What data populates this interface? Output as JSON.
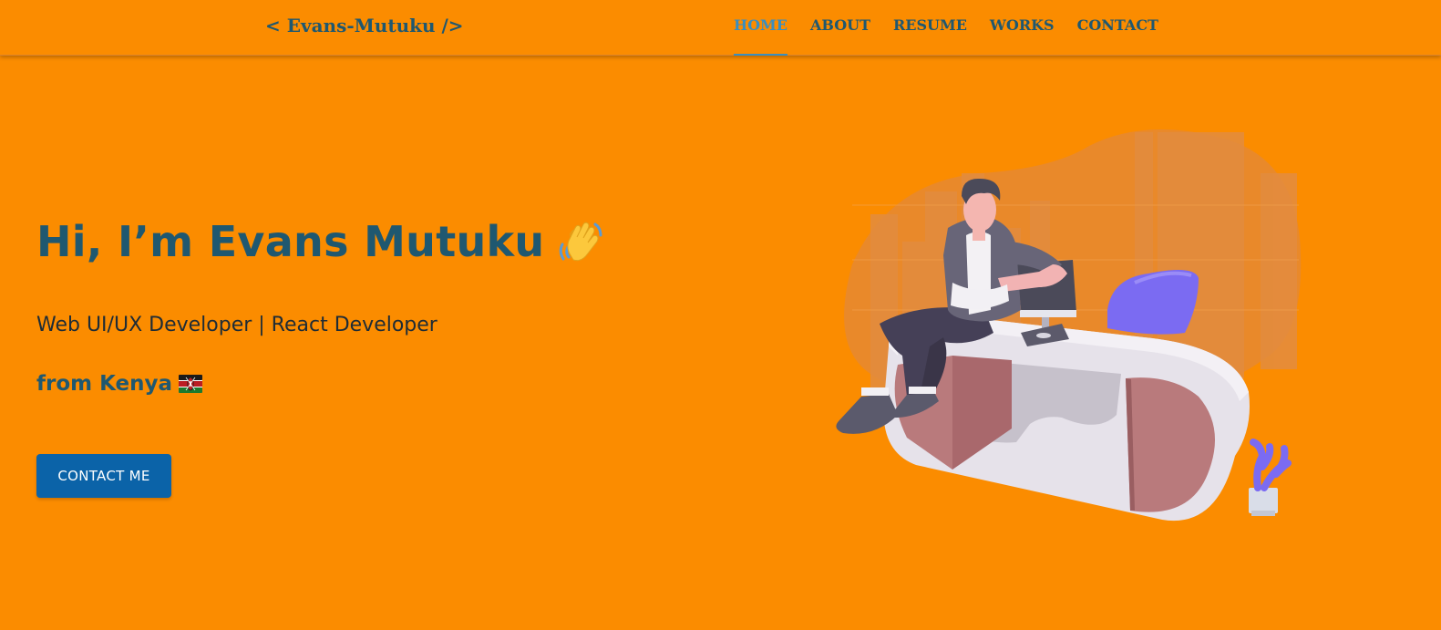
{
  "navbar": {
    "brand": "< Evans-Mutuku />",
    "links": [
      {
        "label": "HOME",
        "active": true
      },
      {
        "label": "ABOUT",
        "active": false
      },
      {
        "label": "RESUME",
        "active": false
      },
      {
        "label": "WORKS",
        "active": false
      },
      {
        "label": "CONTACT",
        "active": false
      }
    ]
  },
  "hero": {
    "greeting": "Hi, I’m Evans Mutuku",
    "greeting_icon": "waving-hand-icon",
    "role": "Web UI/UX Developer | React Developer",
    "from": "from Kenya",
    "from_icon": "kenya-flag-icon",
    "cta_label": "CONTACT ME",
    "illustration_icon": "developer-at-desk-illustration"
  },
  "colors": {
    "background": "#fb8c00",
    "primary_text": "#1f5870",
    "active_nav": "#3a8ec0",
    "button": "#0b63a8"
  }
}
